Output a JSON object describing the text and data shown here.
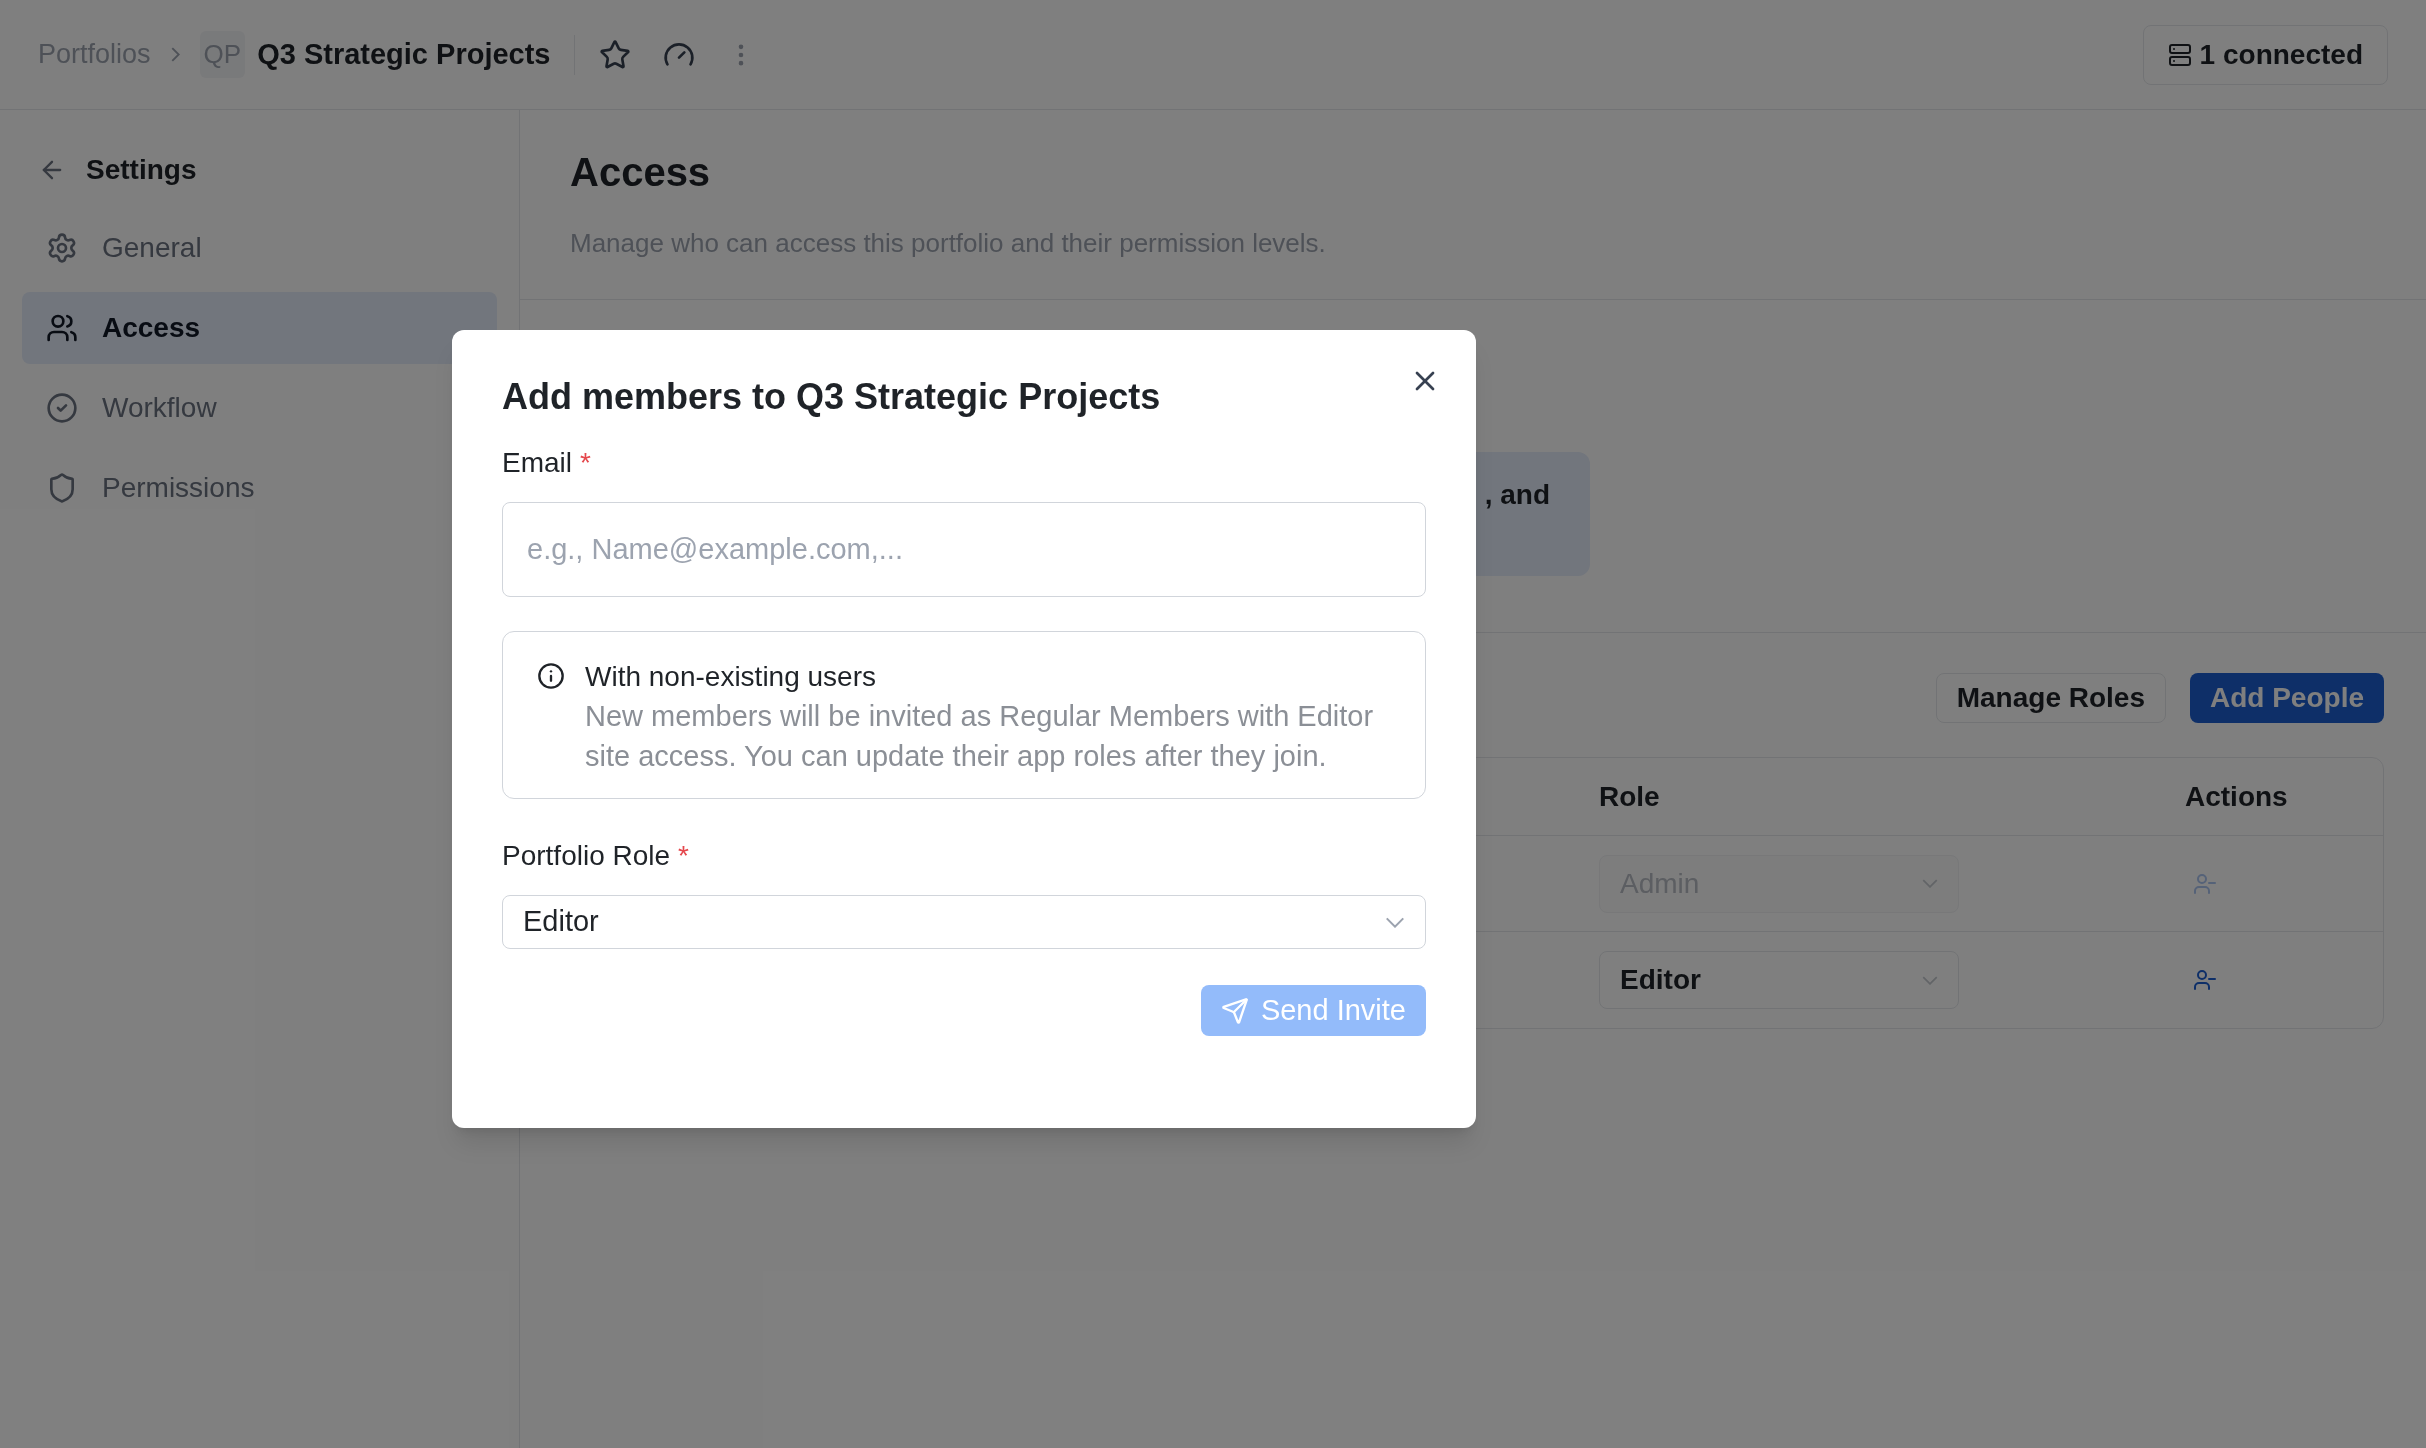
{
  "breadcrumb": {
    "root": "Portfolios",
    "badge": "QP",
    "title": "Q3 Strategic Projects"
  },
  "connection": {
    "label": "1 connected"
  },
  "sidebar": {
    "back_label": "Settings",
    "items": [
      {
        "label": "General",
        "selected": false
      },
      {
        "label": "Access",
        "selected": true
      },
      {
        "label": "Workflow",
        "selected": false
      },
      {
        "label": "Permissions",
        "selected": false
      }
    ]
  },
  "page": {
    "title": "Access",
    "description": "Manage who can access this portfolio and their permission levels.",
    "notice_text": ", and"
  },
  "toolbar": [
    {
      "label": "Manage Roles",
      "kind": "secondary"
    },
    {
      "label": "Add People",
      "kind": "primary"
    }
  ],
  "table": {
    "columns": [
      "Role",
      "Actions"
    ],
    "rows": [
      {
        "role": "Admin",
        "disabled": true
      },
      {
        "role": "Editor",
        "disabled": false
      }
    ]
  },
  "dialog": {
    "title": "Add members to Q3 Strategic Projects",
    "email": {
      "label": "Email",
      "required_mark": "*",
      "placeholder": "e.g., Name@example.com,..."
    },
    "info": {
      "title": "With non-existing users",
      "text": "New members will be invited as Regular Members with Editor site access. You can update their app roles after they join."
    },
    "role": {
      "label": "Portfolio Role",
      "required_mark": "*",
      "value": "Editor"
    },
    "submit": {
      "label": "Send Invite",
      "disabled": true
    }
  }
}
